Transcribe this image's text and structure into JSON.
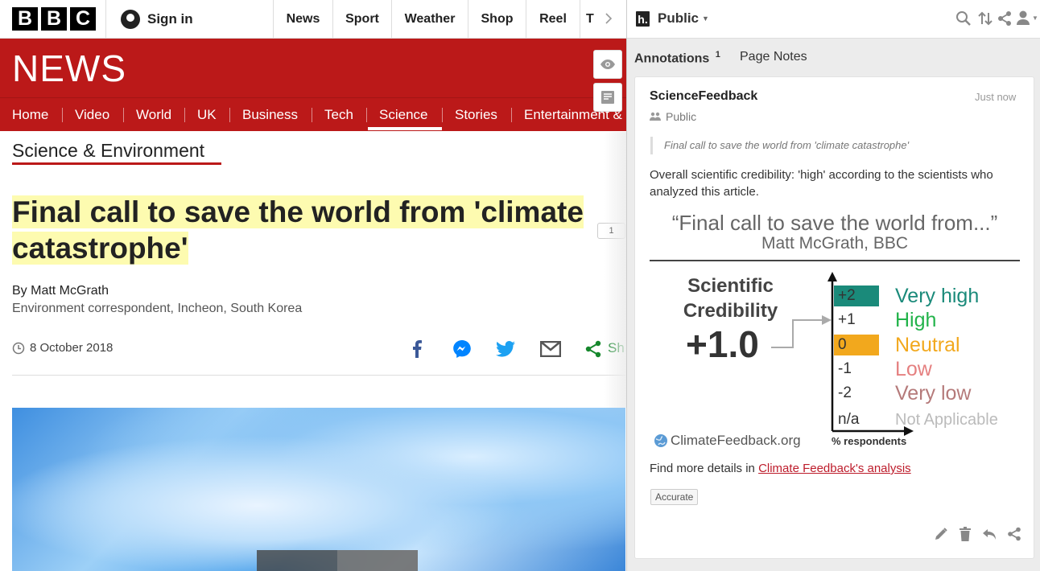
{
  "bbc": {
    "logo": [
      "B",
      "B",
      "C"
    ],
    "sign_in": "Sign in",
    "topnav": [
      "News",
      "Sport",
      "Weather",
      "Shop",
      "Reel",
      "T"
    ],
    "news_word": "NEWS",
    "secnav": [
      "Home",
      "Video",
      "World",
      "UK",
      "Business",
      "Tech",
      "Science",
      "Stories",
      "Entertainment &"
    ],
    "secnav_active": "Science"
  },
  "article": {
    "section": "Science & Environment",
    "headline_line1": "Final call to save the world from 'climate",
    "headline_line2": "catastrophe'",
    "byline": "By Matt McGrath",
    "role": "Environment correspondent, Incheon, South Korea",
    "date": "8 October 2018",
    "share_label": "Sh",
    "annotation_count": "1"
  },
  "hypothesis": {
    "group": "Public",
    "tabs": {
      "annotations": "Annotations",
      "annotations_count": "1",
      "page_notes": "Page Notes"
    },
    "card": {
      "user": "ScienceFeedback",
      "time": "Just now",
      "visibility": "Public",
      "quote": "Final call to save the world from 'climate catastrophe'",
      "body": "Overall scientific credibility: 'high' according to the scientists who analyzed this article.",
      "graphic": {
        "title": "“Final call to save the world from...”",
        "subtitle": "Matt McGrath, BBC",
        "cred_label_1": "Scientific",
        "cred_label_2": "Credibility",
        "score": "+1.0",
        "rows": [
          {
            "value": "+2",
            "label": "Very high",
            "color": "#1a8a7a",
            "box": "#1a8a7a"
          },
          {
            "value": "+1",
            "label": "High",
            "color": "#22b34a",
            "box": ""
          },
          {
            "value": "0",
            "label": "Neutral",
            "color": "#f2a81d",
            "box": "#f2a81d"
          },
          {
            "value": "-1",
            "label": "Low",
            "color": "#e58080",
            "box": ""
          },
          {
            "value": "-2",
            "label": "Very low",
            "color": "#b57a7a",
            "box": ""
          },
          {
            "value": "n/a",
            "label": "Not Applicable",
            "color": "#bbbbbb",
            "box": ""
          }
        ],
        "axis_label": "% respondents",
        "source": "ClimateFeedback.org"
      },
      "details_prefix": "Find more details in ",
      "details_link": "Climate Feedback's analysis",
      "tag": "Accurate"
    }
  }
}
